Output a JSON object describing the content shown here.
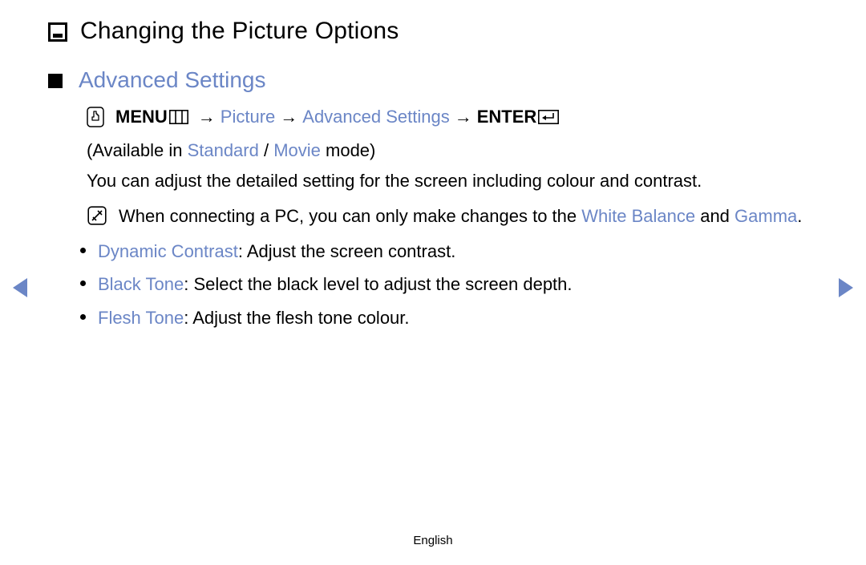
{
  "title": "Changing the Picture Options",
  "section": {
    "heading": "Advanced Settings",
    "path": {
      "menu": "MENU",
      "arrow": "→",
      "picture": "Picture",
      "advanced": "Advanced Settings",
      "enter": "ENTER"
    },
    "available": {
      "prefix": "(Available in ",
      "standard": "Standard",
      "sep": " / ",
      "movie": "Movie",
      "suffix": " mode)"
    },
    "description": "You can adjust the detailed setting for the screen including colour and contrast.",
    "note": {
      "prefix": "When connecting a PC, you can only make changes to the ",
      "wb": "White Balance",
      "mid": " and ",
      "gamma": "Gamma",
      "suffix": "."
    },
    "bullets": [
      {
        "term": "Dynamic Contrast",
        "desc": ": Adjust the screen contrast."
      },
      {
        "term": "Black Tone",
        "desc": ": Select the black level to adjust the screen depth."
      },
      {
        "term": "Flesh Tone",
        "desc": ": Adjust the flesh tone colour."
      }
    ]
  },
  "footer": {
    "language": "English"
  }
}
